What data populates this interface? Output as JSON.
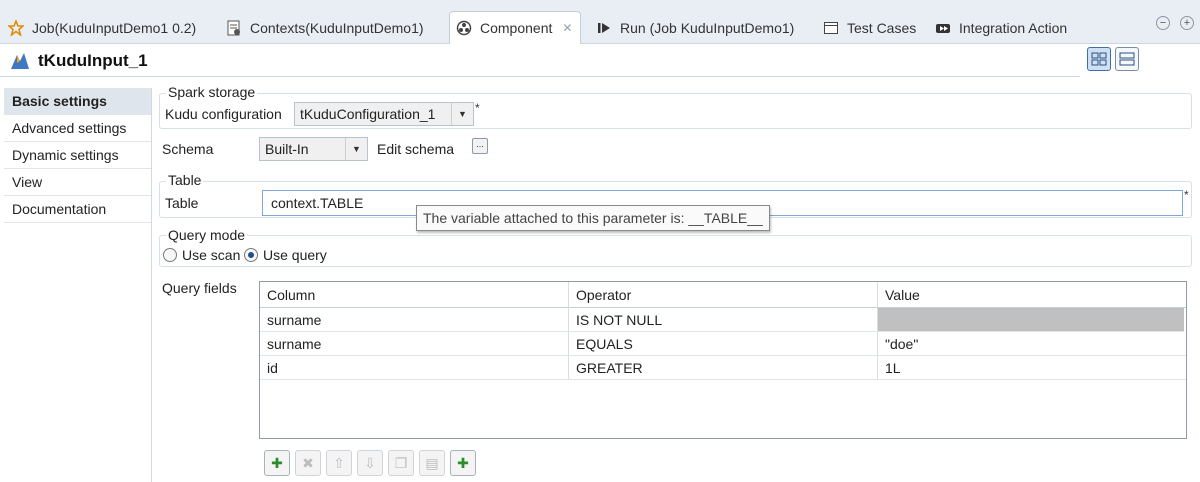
{
  "tabs": [
    {
      "label": "Job(KuduInputDemo1 0.2)",
      "icon": "job-icon"
    },
    {
      "label": "Contexts(KuduInputDemo1)",
      "icon": "contexts-icon"
    },
    {
      "label": "Component",
      "icon": "component-icon"
    },
    {
      "label": "Run (Job KuduInputDemo1)",
      "icon": "run-icon"
    },
    {
      "label": "Test Cases",
      "icon": "test-cases-icon"
    },
    {
      "label": "Integration Action",
      "icon": "integration-action-icon"
    }
  ],
  "active_tab": "Component",
  "component_title": "tKuduInput_1",
  "nav": {
    "items": [
      "Basic settings",
      "Advanced settings",
      "Dynamic settings",
      "View",
      "Documentation"
    ],
    "active": "Basic settings"
  },
  "spark_storage": {
    "legend": "Spark storage",
    "kudu_config_label": "Kudu configuration",
    "kudu_config_value": "tKuduConfiguration_1",
    "required_mark": "*"
  },
  "schema": {
    "label": "Schema",
    "value": "Built-In",
    "edit_label": "Edit schema",
    "edit_button": "..."
  },
  "table_group": {
    "legend": "Table",
    "label": "Table",
    "value": "context.TABLE",
    "required_mark": "*",
    "tooltip": "The variable attached to this parameter is: __TABLE__"
  },
  "query_mode": {
    "legend": "Query mode",
    "options": [
      "Use scan",
      "Use query"
    ],
    "selected": "Use query"
  },
  "query_fields": {
    "label": "Query fields",
    "columns": [
      "Column",
      "Operator",
      "Value"
    ],
    "rows": [
      [
        "surname",
        "IS NOT NULL",
        ""
      ],
      [
        "surname",
        "EQUALS",
        "\"doe\""
      ],
      [
        "id",
        "GREATER",
        "1L"
      ]
    ]
  },
  "toolbar": {
    "buttons": [
      {
        "name": "add-row-button",
        "symbol": "✚",
        "enabled": true
      },
      {
        "name": "remove-row-button",
        "symbol": "✖",
        "enabled": false
      },
      {
        "name": "move-up-button",
        "symbol": "⇧",
        "enabled": false
      },
      {
        "name": "move-down-button",
        "symbol": "⇩",
        "enabled": false
      },
      {
        "name": "copy-button",
        "symbol": "❐",
        "enabled": false
      },
      {
        "name": "paste-button",
        "symbol": "▤",
        "enabled": false
      },
      {
        "name": "add-all-button",
        "symbol": "✚",
        "enabled": true
      }
    ]
  },
  "colors": {
    "tab_bar": "#e9eef5",
    "accent": "#3f6fab",
    "add_green": "#2e8b2e"
  }
}
